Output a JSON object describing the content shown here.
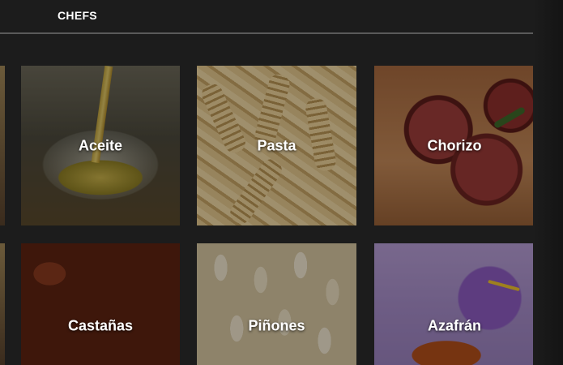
{
  "header": {
    "nav_label": "CHEFS"
  },
  "grid": {
    "items": [
      {
        "label": "Aceite",
        "art": "olive-oil"
      },
      {
        "label": "Pasta",
        "art": "fusilli-pasta"
      },
      {
        "label": "Chorizo",
        "art": "sliced-chorizo"
      },
      {
        "label": "Castañas",
        "art": "chestnuts"
      },
      {
        "label": "Piñones",
        "art": "pine-nuts"
      },
      {
        "label": "Azafrán",
        "art": "saffron-flower"
      }
    ]
  },
  "colors": {
    "background": "#1c1c1c",
    "divider": "#5a5a5a",
    "label_text": "#ffffff"
  }
}
